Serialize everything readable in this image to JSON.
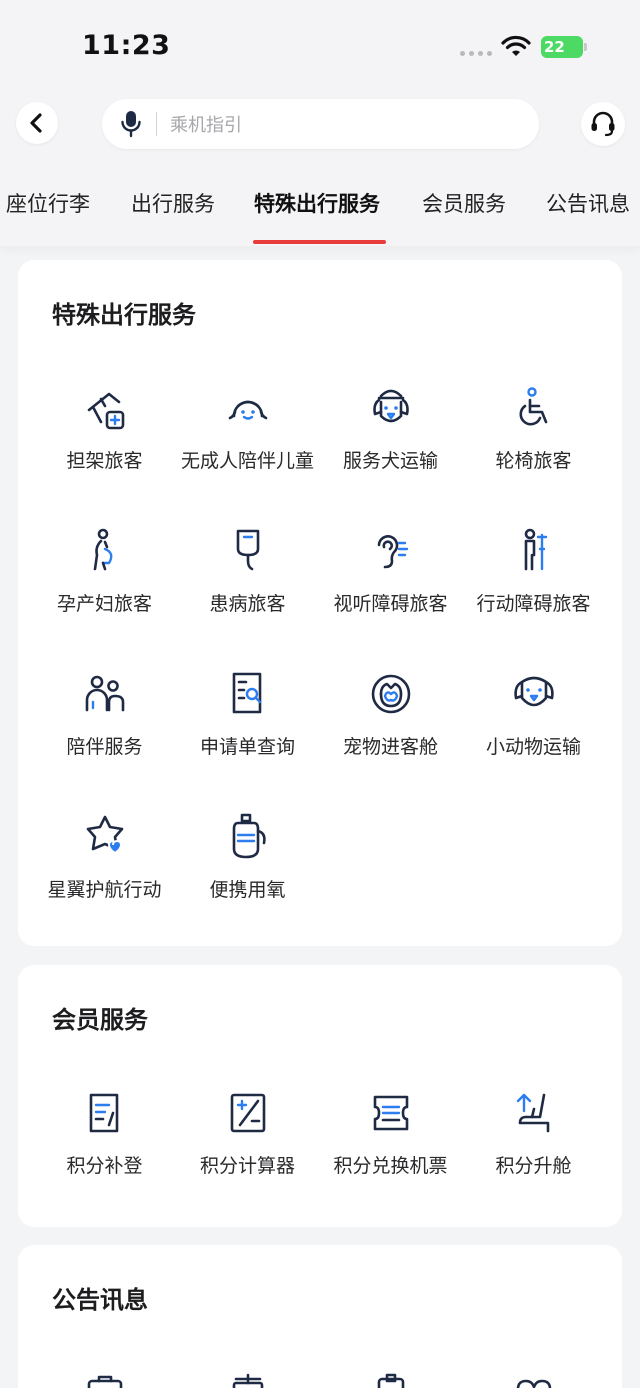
{
  "status_bar": {
    "time": "11:23",
    "battery": "22"
  },
  "search": {
    "placeholder": "乘机指引"
  },
  "tabs": [
    {
      "label": "座位行李"
    },
    {
      "label": "出行服务"
    },
    {
      "label": "特殊出行服务",
      "active": true
    },
    {
      "label": "会员服务"
    },
    {
      "label": "公告讯息"
    }
  ],
  "special_services": {
    "title": "特殊出行服务",
    "items": [
      {
        "label": "担架旅客",
        "icon": "stretcher-icon"
      },
      {
        "label": "无成人陪伴儿童",
        "icon": "child-icon"
      },
      {
        "label": "服务犬运输",
        "icon": "service-dog-icon"
      },
      {
        "label": "轮椅旅客",
        "icon": "wheelchair-icon"
      },
      {
        "label": "孕产妇旅客",
        "icon": "pregnant-icon"
      },
      {
        "label": "患病旅客",
        "icon": "iv-drip-icon"
      },
      {
        "label": "视听障碍旅客",
        "icon": "hearing-icon"
      },
      {
        "label": "行动障碍旅客",
        "icon": "crutch-icon"
      },
      {
        "label": "陪伴服务",
        "icon": "companion-icon"
      },
      {
        "label": "申请单查询",
        "icon": "form-search-icon"
      },
      {
        "label": "宠物进客舱",
        "icon": "pet-cabin-icon"
      },
      {
        "label": "小动物运输",
        "icon": "small-animal-icon"
      },
      {
        "label": "星翼护航行动",
        "icon": "star-heart-icon"
      },
      {
        "label": "便携用氧",
        "icon": "oxygen-icon"
      }
    ]
  },
  "member_services": {
    "title": "会员服务",
    "items": [
      {
        "label": "积分补登",
        "icon": "points-register-icon"
      },
      {
        "label": "积分计算器",
        "icon": "calculator-icon"
      },
      {
        "label": "积分兑换机票",
        "icon": "ticket-exchange-icon"
      },
      {
        "label": "积分升舱",
        "icon": "seat-upgrade-icon"
      }
    ]
  },
  "announcements": {
    "title": "公告讯息"
  },
  "colors": {
    "accent": "#e83b3b",
    "icon_dark": "#1f2a44",
    "icon_blue": "#2b7df0"
  }
}
